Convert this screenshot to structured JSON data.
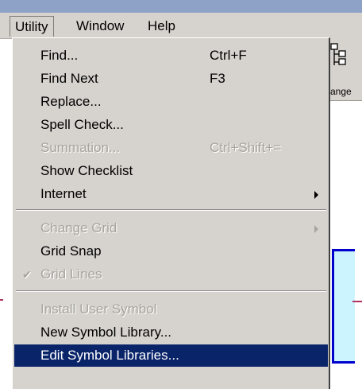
{
  "menubar": {
    "items": [
      {
        "label": "Utility"
      },
      {
        "label": "Window"
      },
      {
        "label": "Help"
      }
    ]
  },
  "toolbar": {
    "partial_button_label": "ange",
    "icon": "org-chart-icon"
  },
  "menu": {
    "items": [
      {
        "label": "Find...",
        "shortcut": "Ctrl+F",
        "enabled": true
      },
      {
        "label": "Find Next",
        "shortcut": "F3",
        "enabled": true
      },
      {
        "label": "Replace...",
        "enabled": true
      },
      {
        "label": "Spell Check...",
        "enabled": true
      },
      {
        "label": "Summation...",
        "shortcut": "Ctrl+Shift+=",
        "enabled": false
      },
      {
        "label": "Show Checklist",
        "enabled": true
      },
      {
        "label": "Internet",
        "submenu": true,
        "enabled": true
      },
      {
        "label": "Change Grid",
        "submenu": true,
        "enabled": false
      },
      {
        "label": "Grid Snap",
        "enabled": true
      },
      {
        "label": "Grid Lines",
        "checked": true,
        "enabled": false
      },
      {
        "label": "Install User Symbol",
        "enabled": false
      },
      {
        "label": "New Symbol Library...",
        "enabled": true
      },
      {
        "label": "Edit Symbol Libraries...",
        "enabled": true,
        "highlighted": true
      }
    ]
  },
  "colors": {
    "menu_bg": "#d6d3ce",
    "highlight": "#0a246a",
    "disabled_text": "#a7a49d"
  }
}
